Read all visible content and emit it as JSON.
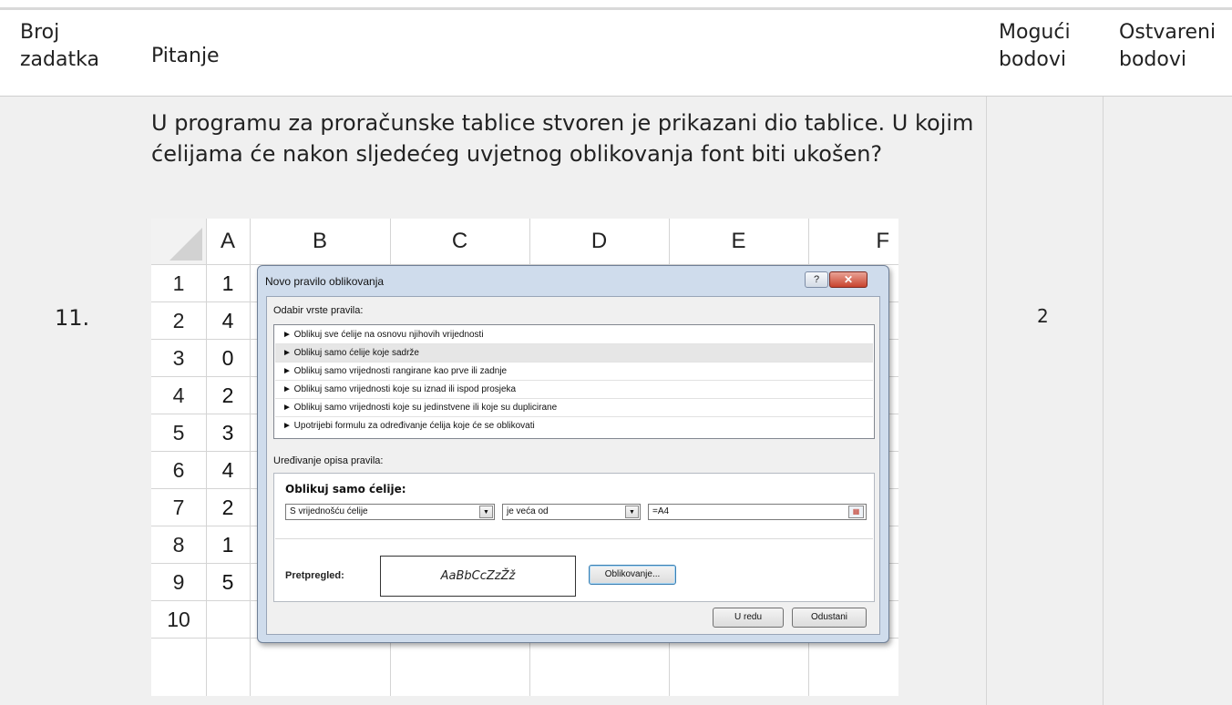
{
  "table": {
    "headers": {
      "number": "Broj zadatka",
      "question": "Pitanje",
      "possible_points": "Mogući bodovi",
      "achieved_points": "Ostvareni bodovi"
    },
    "row": {
      "number": "11.",
      "question": "U programu za proračunske tablice stvoren je prikazani dio tablice. U kojim ćelijama će nakon sljedećeg uvjetnog oblikovanja font biti ukošen?",
      "possible_points": "2",
      "achieved_points": ""
    }
  },
  "spreadsheet": {
    "columns": [
      "A",
      "B",
      "C",
      "D",
      "E",
      "F"
    ],
    "rows": [
      "1",
      "2",
      "3",
      "4",
      "5",
      "6",
      "7",
      "8",
      "9",
      "10"
    ],
    "column_a_values": [
      "1",
      "4",
      "0",
      "2",
      "3",
      "4",
      "2",
      "1",
      "5",
      ""
    ]
  },
  "dialog": {
    "title": "Novo pravilo oblikovanja",
    "help_label": "?",
    "close_label": "✕",
    "rule_type_label": "Odabir vrste pravila:",
    "rules": [
      "► Oblikuj sve ćelije na osnovu njihovih vrijednosti",
      "► Oblikuj samo ćelije koje sadrže",
      "► Oblikuj samo vrijednosti rangirane kao prve ili zadnje",
      "► Oblikuj samo vrijednosti koje su iznad ili ispod prosjeka",
      "► Oblikuj samo vrijednosti koje su jedinstvene ili koje su duplicirane",
      "► Upotrijebi formulu za određivanje ćelija koje će se oblikovati"
    ],
    "selected_rule_index": 1,
    "edit_label": "Uređivanje opisa pravila:",
    "desc_title": "Oblikuj samo ćelije:",
    "condition_field": "S vrijednošću ćelije",
    "operator_field": "je veća od",
    "value_field": "=A4",
    "preview_label": "Pretpregled:",
    "preview_text": "AaBbCcZzŽž",
    "format_button": "Oblikovanje...",
    "ok_button": "U redu",
    "cancel_button": "Odustani"
  }
}
